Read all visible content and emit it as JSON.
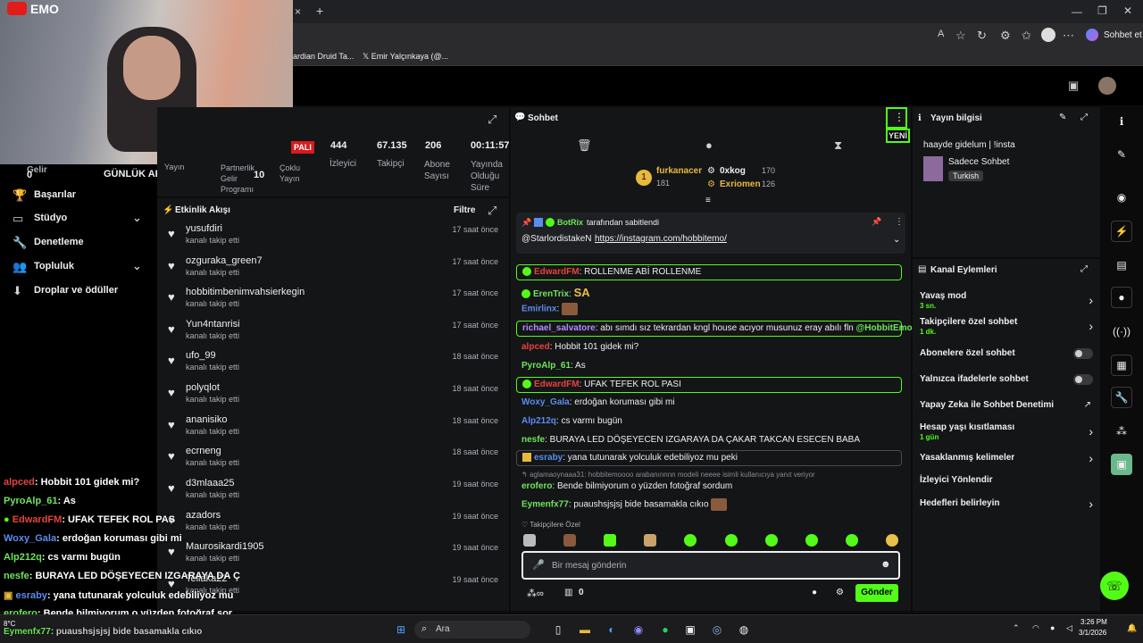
{
  "browser": {
    "tab_close": "×",
    "tab_new": "+",
    "bookmarks": [
      "ardian Druid Ta...",
      "Emir Yalçınkaya (@..."
    ],
    "chat_button": "Sohbet et"
  },
  "stream_overlay": {
    "logo": "EMO",
    "gelir_label": "Gelir",
    "gelir_value": "0",
    "gunluk_abone": "GÜNLÜK ABONE",
    "chat_lines": [
      {
        "user": "alpced",
        "text": ": Hobbit 101 gidek mi?",
        "color": "#e5443d"
      },
      {
        "user": "PyroAlp_61",
        "text": ": As",
        "color": "#6ee55b"
      },
      {
        "user": "EdwardFM",
        "text": ": UFAK TEFEK ROL PAS",
        "color": "#e5443d"
      },
      {
        "user": "Woxy_Gala",
        "text": ": erdoğan koruması gibi mi",
        "color": "#5a8dee"
      },
      {
        "user": "Alp212q",
        "text": ": cs varmı bugün",
        "color": "#6ee55b"
      },
      {
        "user": "nesfe",
        "text": ": BURAYA LED DÖŞEYECEN IZGARAYA DA Ç",
        "color": "#6ee55b"
      },
      {
        "user": "esraby",
        "text": ": yana tutunarak yolculuk edebiliyoz mu",
        "color": "#5a8dee"
      },
      {
        "user": "erofero",
        "text": ": Bende bilmiyorum o yüzden fotoğraf sor",
        "color": "#6ee55b"
      },
      {
        "user": "Eymenfx77",
        "text": ": puaushsjsjsj bide basamakla cıkıo",
        "color": "#6ee55b"
      }
    ]
  },
  "sidebar": {
    "items": [
      {
        "label": "Başarılar"
      },
      {
        "label": "Stüdyo"
      },
      {
        "label": "Denetleme"
      },
      {
        "label": "Topluluk"
      },
      {
        "label": "Droplar ve ödüller"
      }
    ]
  },
  "stats": {
    "live_badge": "PALI",
    "yayin_label": "Yayın",
    "partner_label": "Partnerlik Gelir Programı",
    "partner_value": "10",
    "coklu_label": "Çoklu Yayın",
    "viewers": "444",
    "viewers_label": "İzleyici",
    "followers": "67.135",
    "followers_label": "Takipçi",
    "subs": "206",
    "subs_label": "Abone Sayısı",
    "uptime": "00:11:57",
    "uptime_label": "Yayında Olduğu Süre"
  },
  "activity": {
    "title": "Etkinlik Akışı",
    "filter": "Filtre",
    "events": [
      {
        "user": "yusufdiri",
        "action": "kanalı takip etti",
        "time": "17 saat önce"
      },
      {
        "user": "ozguraka_green7",
        "action": "kanalı takip etti",
        "time": "17 saat önce"
      },
      {
        "user": "hobbitimbenimvahsierkegin",
        "action": "kanalı takip etti",
        "time": "17 saat önce"
      },
      {
        "user": "Yun4ntanrisi",
        "action": "kanalı takip etti",
        "time": "17 saat önce"
      },
      {
        "user": "ufo_99",
        "action": "kanalı takip etti",
        "time": "18 saat önce"
      },
      {
        "user": "polyqlot",
        "action": "kanalı takip etti",
        "time": "18 saat önce"
      },
      {
        "user": "ananisiko",
        "action": "kanalı takip etti",
        "time": "18 saat önce"
      },
      {
        "user": "ecrneng",
        "action": "kanalı takip etti",
        "time": "18 saat önce"
      },
      {
        "user": "d3mlaaa25",
        "action": "kanalı takip etti",
        "time": "19 saat önce"
      },
      {
        "user": "azadors",
        "action": "kanalı takip etti",
        "time": "19 saat önce"
      },
      {
        "user": "Maurosikardi1905",
        "action": "kanalı takip etti",
        "time": "19 saat önce"
      },
      {
        "user": "Tellaka22",
        "action": "kanalı takip etti",
        "time": "19 saat önce"
      }
    ]
  },
  "chat": {
    "title": "Sohbet",
    "new_badge": "YENİ",
    "leaderboard": [
      {
        "name": "furkanacer",
        "value": "181"
      },
      {
        "name": "0xkog",
        "value": "170"
      },
      {
        "name": "Exriomen",
        "value": "126"
      }
    ],
    "pinned_by": "BotRix",
    "pinned_suffix": "tarafından sabitlendi",
    "pinned_mention": "@StarlordistakeN",
    "pinned_link": "https://instagram.com/hobbitemo/",
    "messages": [
      {
        "user": "EdwardFM",
        "text": ": ROLLENME ABİ ROLLENME"
      },
      {
        "user": "ErenTrix",
        "text": ":"
      },
      {
        "user": "Emirlinx",
        "text": ":"
      },
      {
        "user": "richael_salvatore",
        "text": ": abı sımdı sız tekrardan kngl house acıyor musunuz eray abılı fln",
        "mention": "@HobbitEmo"
      },
      {
        "user": "alpced",
        "text": ": Hobbit 101 gidek mi?"
      },
      {
        "user": "PyroAlp_61",
        "text": ": As"
      },
      {
        "user": "EdwardFM",
        "text": ": UFAK TEFEK ROL PASI"
      },
      {
        "user": "Woxy_Gala",
        "text": ": erdoğan koruması gibi mi"
      },
      {
        "user": "Alp212q",
        "text": ": cs varmı bugün"
      },
      {
        "user": "nesfe",
        "text": ": BURAYA LED DÖŞEYECEN IZGARAYA DA ÇAKAR TAKCAN ESECEN BABA"
      },
      {
        "user": "esraby",
        "text": ": yana tutunarak yolculuk edebiliyoz mu peki"
      },
      {
        "user": "",
        "text": "aglamaoynaaa31: hobbitemoooo arabanınnnn modeli neeee isimli kullanıcıya yanıt veriyor"
      },
      {
        "user": "erofero",
        "text": ": Bende bilmiyorum o yüzden fotoğraf sordum"
      },
      {
        "user": "Eymenfx77",
        "text": ": puaushsjsjsj bide basamakla cıkıo"
      }
    ],
    "followers_only": "Takipçilere Özel",
    "input_placeholder": "Bir mesaj gönderin",
    "points": "0",
    "send": "Gönder"
  },
  "stream_info": {
    "title": "Yayın bilgisi",
    "stream_title": "haayde gidelum | !insta",
    "category": "Sadece Sohbet",
    "language": "Turkish"
  },
  "channel_actions": {
    "title": "Kanal Eylemleri",
    "slow_mode": "Yavaş mod",
    "slow_mode_value": "3 sn.",
    "followers_chat": "Takipçilere özel sohbet",
    "followers_chat_value": "1 dk.",
    "subs_chat": "Abonelere özel sohbet",
    "emote_chat": "Yalnızca ifadelerle sohbet",
    "ai_mod": "Yapay Zeka ile Sohbet Denetimi",
    "age_restrict": "Hesap yaşı kısıtlaması",
    "age_restrict_value": "1 gün",
    "banned_words": "Yasaklanmış kelimeler",
    "redirect": "İzleyici Yönlendir",
    "target": "Hedefleri belirleyin"
  },
  "taskbar": {
    "weather": "8°C",
    "search": "Ara",
    "time": "3:26 PM",
    "date": "3/1/2026"
  }
}
